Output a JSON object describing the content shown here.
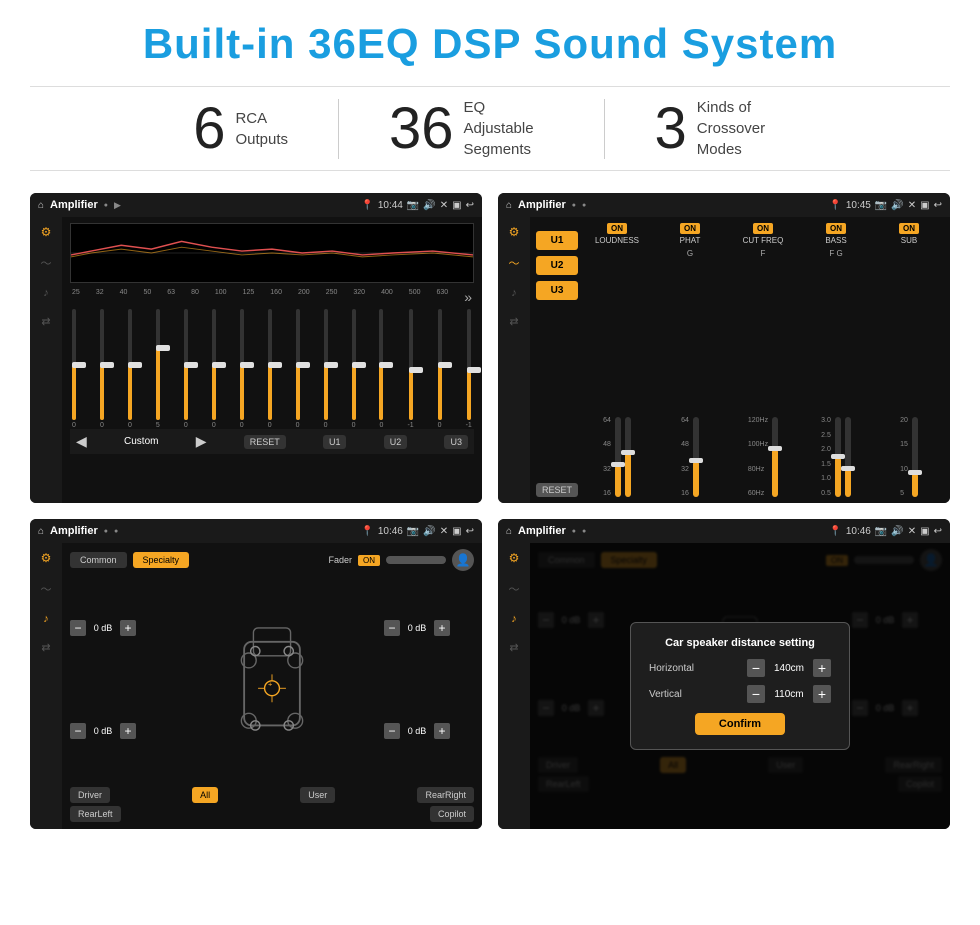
{
  "page": {
    "title": "Built-in 36EQ DSP Sound System",
    "stats": [
      {
        "number": "6",
        "label": "RCA\nOutputs"
      },
      {
        "number": "36",
        "label": "EQ Adjustable\nSegments"
      },
      {
        "number": "3",
        "label": "Kinds of\nCrossover Modes"
      }
    ]
  },
  "screen1": {
    "topbar": {
      "title": "Amplifier",
      "time": "10:44"
    },
    "eq_freqs": [
      "25",
      "32",
      "40",
      "50",
      "63",
      "80",
      "100",
      "125",
      "160",
      "200",
      "250",
      "320",
      "400",
      "500",
      "630"
    ],
    "eq_values": [
      "0",
      "0",
      "0",
      "5",
      "0",
      "0",
      "0",
      "0",
      "0",
      "0",
      "0",
      "0",
      "-1",
      "0",
      "-1"
    ],
    "bottom_label": "Custom",
    "buttons": [
      "RESET",
      "U1",
      "U2",
      "U3"
    ]
  },
  "screen2": {
    "topbar": {
      "title": "Amplifier",
      "time": "10:45"
    },
    "u_buttons": [
      "U1",
      "U2",
      "U3"
    ],
    "active_u": "U3",
    "columns": [
      {
        "on_label": "ON",
        "name": "LOUDNESS",
        "labels": [
          "64",
          "48",
          "32",
          "16"
        ]
      },
      {
        "on_label": "ON",
        "name": "PHAT",
        "letters": "G",
        "labels": [
          "64",
          "48",
          "32",
          "16"
        ]
      },
      {
        "on_label": "ON",
        "name": "CUT FREQ",
        "letters": "F",
        "freq_labels": [
          "120Hz",
          "100Hz",
          "80Hz",
          "60Hz"
        ]
      },
      {
        "on_label": "ON",
        "name": "BASS",
        "letters": "F  G",
        "labels": [
          "3.0",
          "2.5",
          "2.0",
          "1.5",
          "1.0",
          "0.5"
        ]
      },
      {
        "on_label": "ON",
        "name": "SUB",
        "labels": [
          "20",
          "15",
          "10",
          "5"
        ]
      }
    ],
    "reset_label": "RESET"
  },
  "screen3": {
    "topbar": {
      "title": "Amplifier",
      "time": "10:46"
    },
    "tabs": [
      "Common",
      "Specialty"
    ],
    "active_tab": "Specialty",
    "fader_label": "Fader",
    "fader_on": "ON",
    "speaker_volumes": {
      "front_left": "0 dB",
      "front_right": "0 dB",
      "rear_left": "0 dB",
      "rear_right": "0 dB"
    },
    "bottom_buttons": [
      "Driver",
      "All",
      "User",
      "RearRight",
      "RearLeft",
      "Copilot"
    ]
  },
  "screen4": {
    "topbar": {
      "title": "Amplifier",
      "time": "10:46"
    },
    "tabs": [
      "Common",
      "Specialty"
    ],
    "active_tab": "Specialty",
    "fader_on": "ON",
    "dialog": {
      "title": "Car speaker distance setting",
      "rows": [
        {
          "label": "Horizontal",
          "value": "140cm"
        },
        {
          "label": "Vertical",
          "value": "110cm"
        }
      ],
      "confirm_label": "Confirm"
    },
    "bottom_buttons": [
      "Driver",
      "All",
      "User",
      "RearRight",
      "RearLeft",
      "Copilot"
    ]
  },
  "icons": {
    "home": "⌂",
    "menu": "☰",
    "dot": "●",
    "location": "📍",
    "camera": "📷",
    "volume": "🔊",
    "close": "✕",
    "square": "▣",
    "back": "↩",
    "eq": "≡",
    "wave": "〜",
    "speaker": "♪",
    "settings": "⚙",
    "play": "▶",
    "prev": "◀",
    "next": "▶",
    "plus": "+",
    "minus": "−",
    "person": "👤",
    "arrows": "⇄"
  }
}
